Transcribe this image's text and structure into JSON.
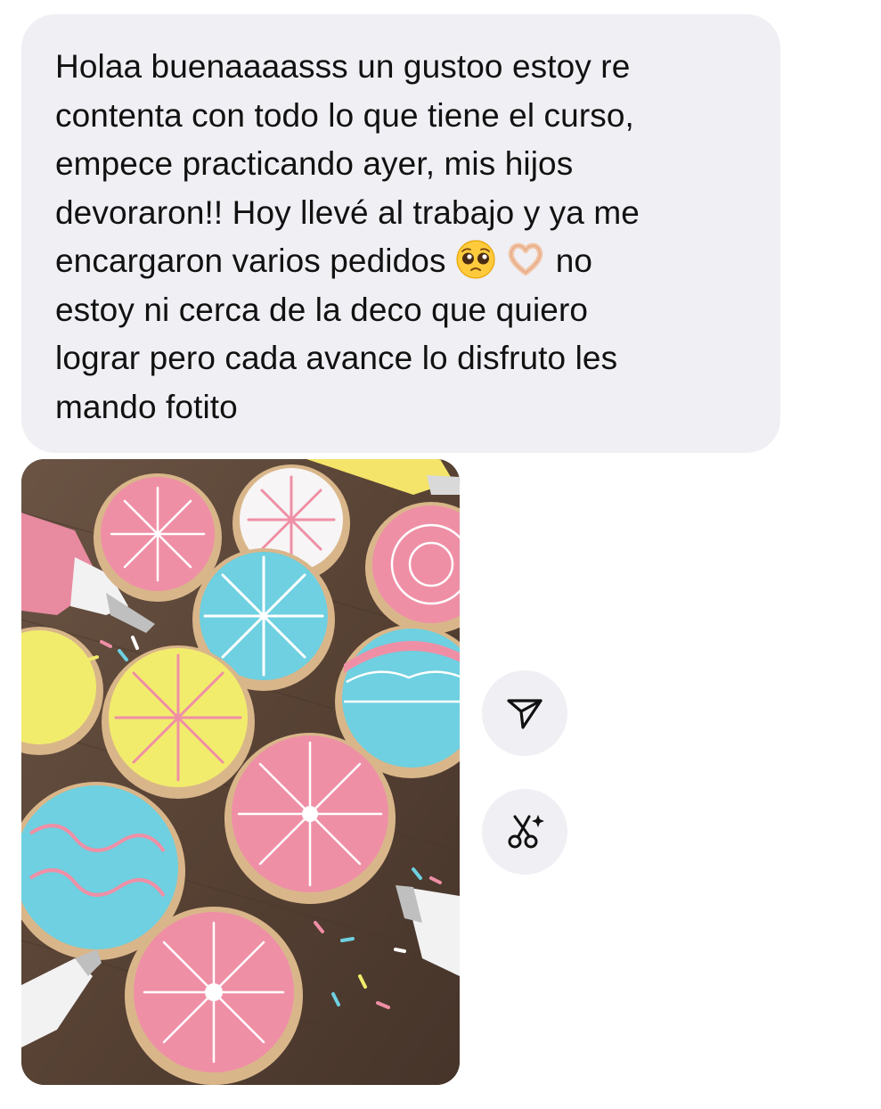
{
  "message": {
    "line1": "Holaa buenaaaasss un gustoo estoy re",
    "line2": "contenta con todo lo que tiene el curso,",
    "line3": "empece practicando ayer, mis hijos",
    "line4": "devoraron!! Hoy llevé al trabajo y ya me",
    "line5_before": "encargaron varios pedidos",
    "line5_after": "no",
    "line6": "estoy ni cerca de la deco que quiero",
    "line7": "lograr pero cada avance lo disfruto les",
    "line8": "mando fotito",
    "emojis": [
      "pleading-face-emoji",
      "heart-hands-emoji"
    ]
  },
  "attachment": {
    "type": "photo",
    "subject": "decorated-cookies-photo"
  },
  "actions": [
    {
      "icon": "share-icon"
    },
    {
      "icon": "ai-scissors-icon"
    }
  ],
  "colors": {
    "bubble": "#efeff4",
    "text": "#111111",
    "action_bg": "#efeff4",
    "icon": "#111111"
  }
}
